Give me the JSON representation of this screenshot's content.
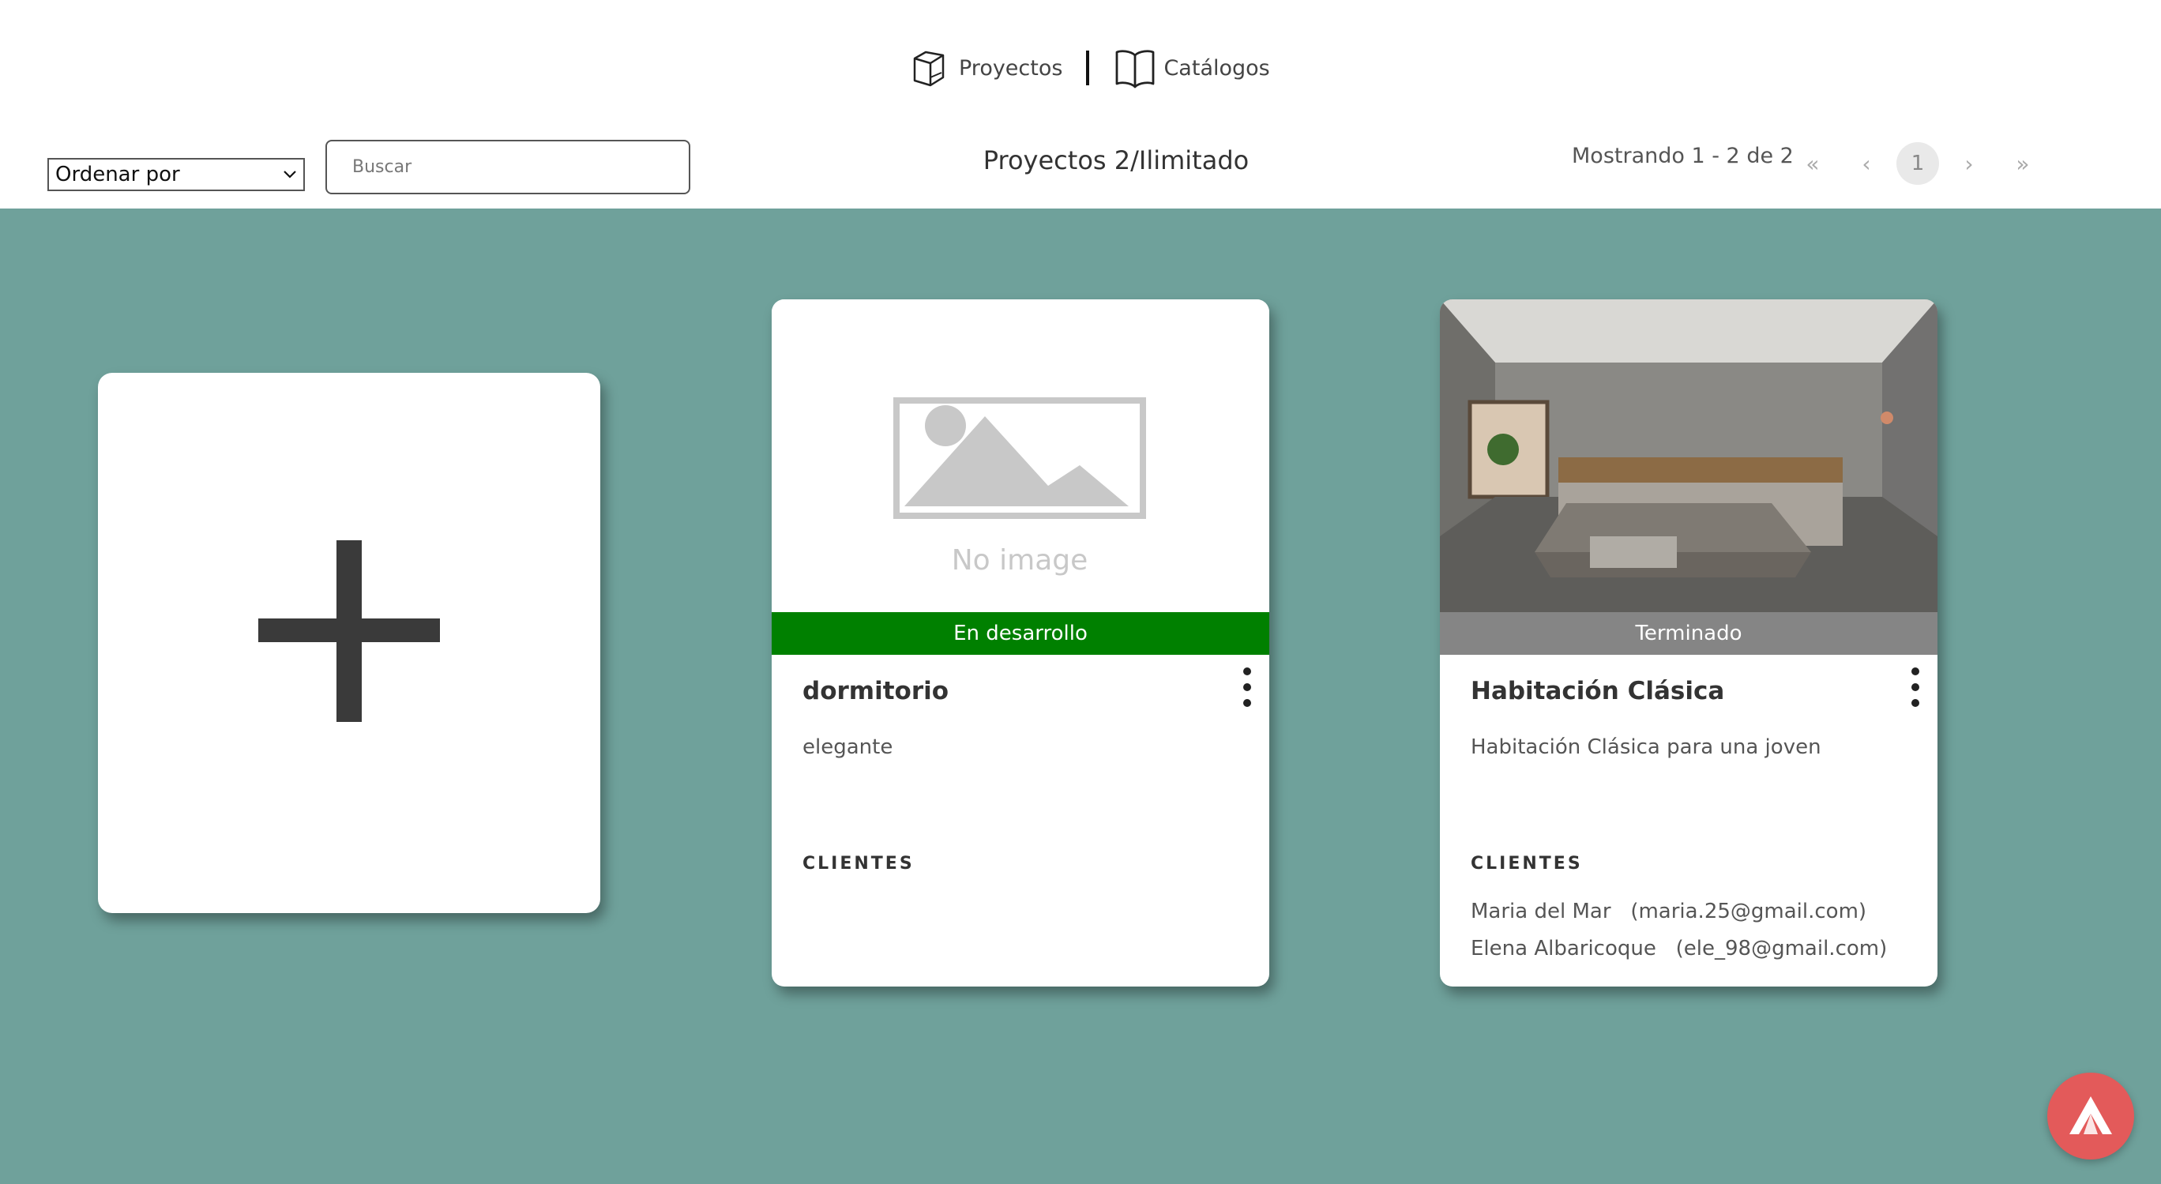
{
  "nav": {
    "projects_label": "Proyectos",
    "catalogs_label": "Catálogos",
    "projects_icon": "box-3d-icon",
    "catalogs_icon": "open-book-icon"
  },
  "toolbar": {
    "sort_label": "Ordenar por",
    "search_placeholder": "Buscar",
    "title": "Proyectos 2/Ilimitado",
    "pager_text": "Mostrando 1 - 2 de 2",
    "pager_first": "«",
    "pager_prev": "‹",
    "pager_current": "1",
    "pager_next": "›",
    "pager_last": "»"
  },
  "cards": [
    {
      "image_text": "No image",
      "status": "En desarrollo",
      "status_color": "#008000",
      "title": "dormitorio",
      "description": "elegante",
      "clients_label": "CLIENTES",
      "clients": []
    },
    {
      "status": "Terminado",
      "status_color": "#858585",
      "title": "Habitación Clásica",
      "description": "Habitación Clásica para una joven",
      "clients_label": "CLIENTES",
      "clients": [
        "Maria del Mar   (maria.25@gmail.com)",
        "Elena Albaricoque   (ele_98@gmail.com)"
      ]
    }
  ],
  "colors": {
    "background": "#6fa19b",
    "fab": "#e35a5a"
  }
}
